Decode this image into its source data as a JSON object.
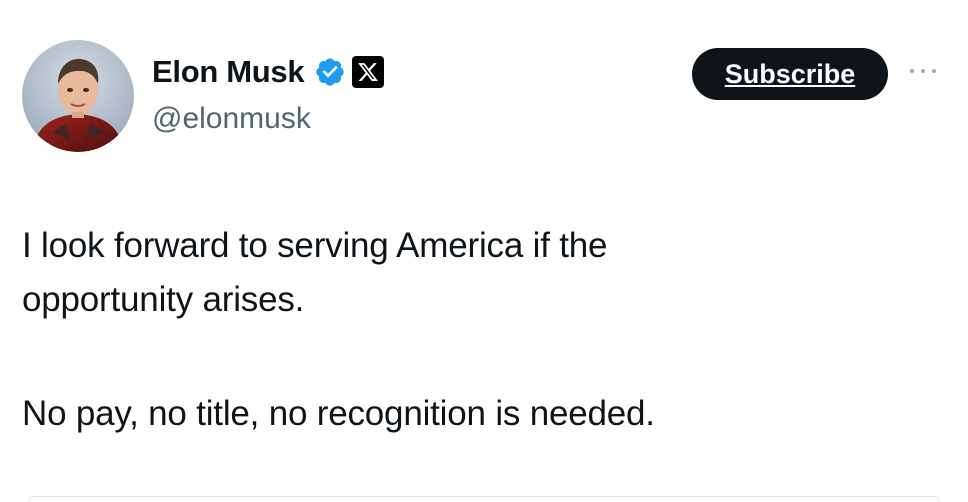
{
  "author": {
    "display_name": "Elon Musk",
    "handle": "@elonmusk",
    "verified": true,
    "verified_color": "#1d9bf0",
    "affiliation_badge": "x-logo-icon"
  },
  "actions": {
    "subscribe_label": "Subscribe",
    "more_icon": "more-horizontal-icon"
  },
  "tweet": {
    "lines": [
      "I look forward to serving America if the",
      "opportunity arises.",
      "No pay, no title, no recognition is needed."
    ]
  },
  "colors": {
    "text": "#0f1419",
    "secondary_text": "#536471",
    "button_bg": "#0f1419",
    "button_text": "#ffffff"
  }
}
